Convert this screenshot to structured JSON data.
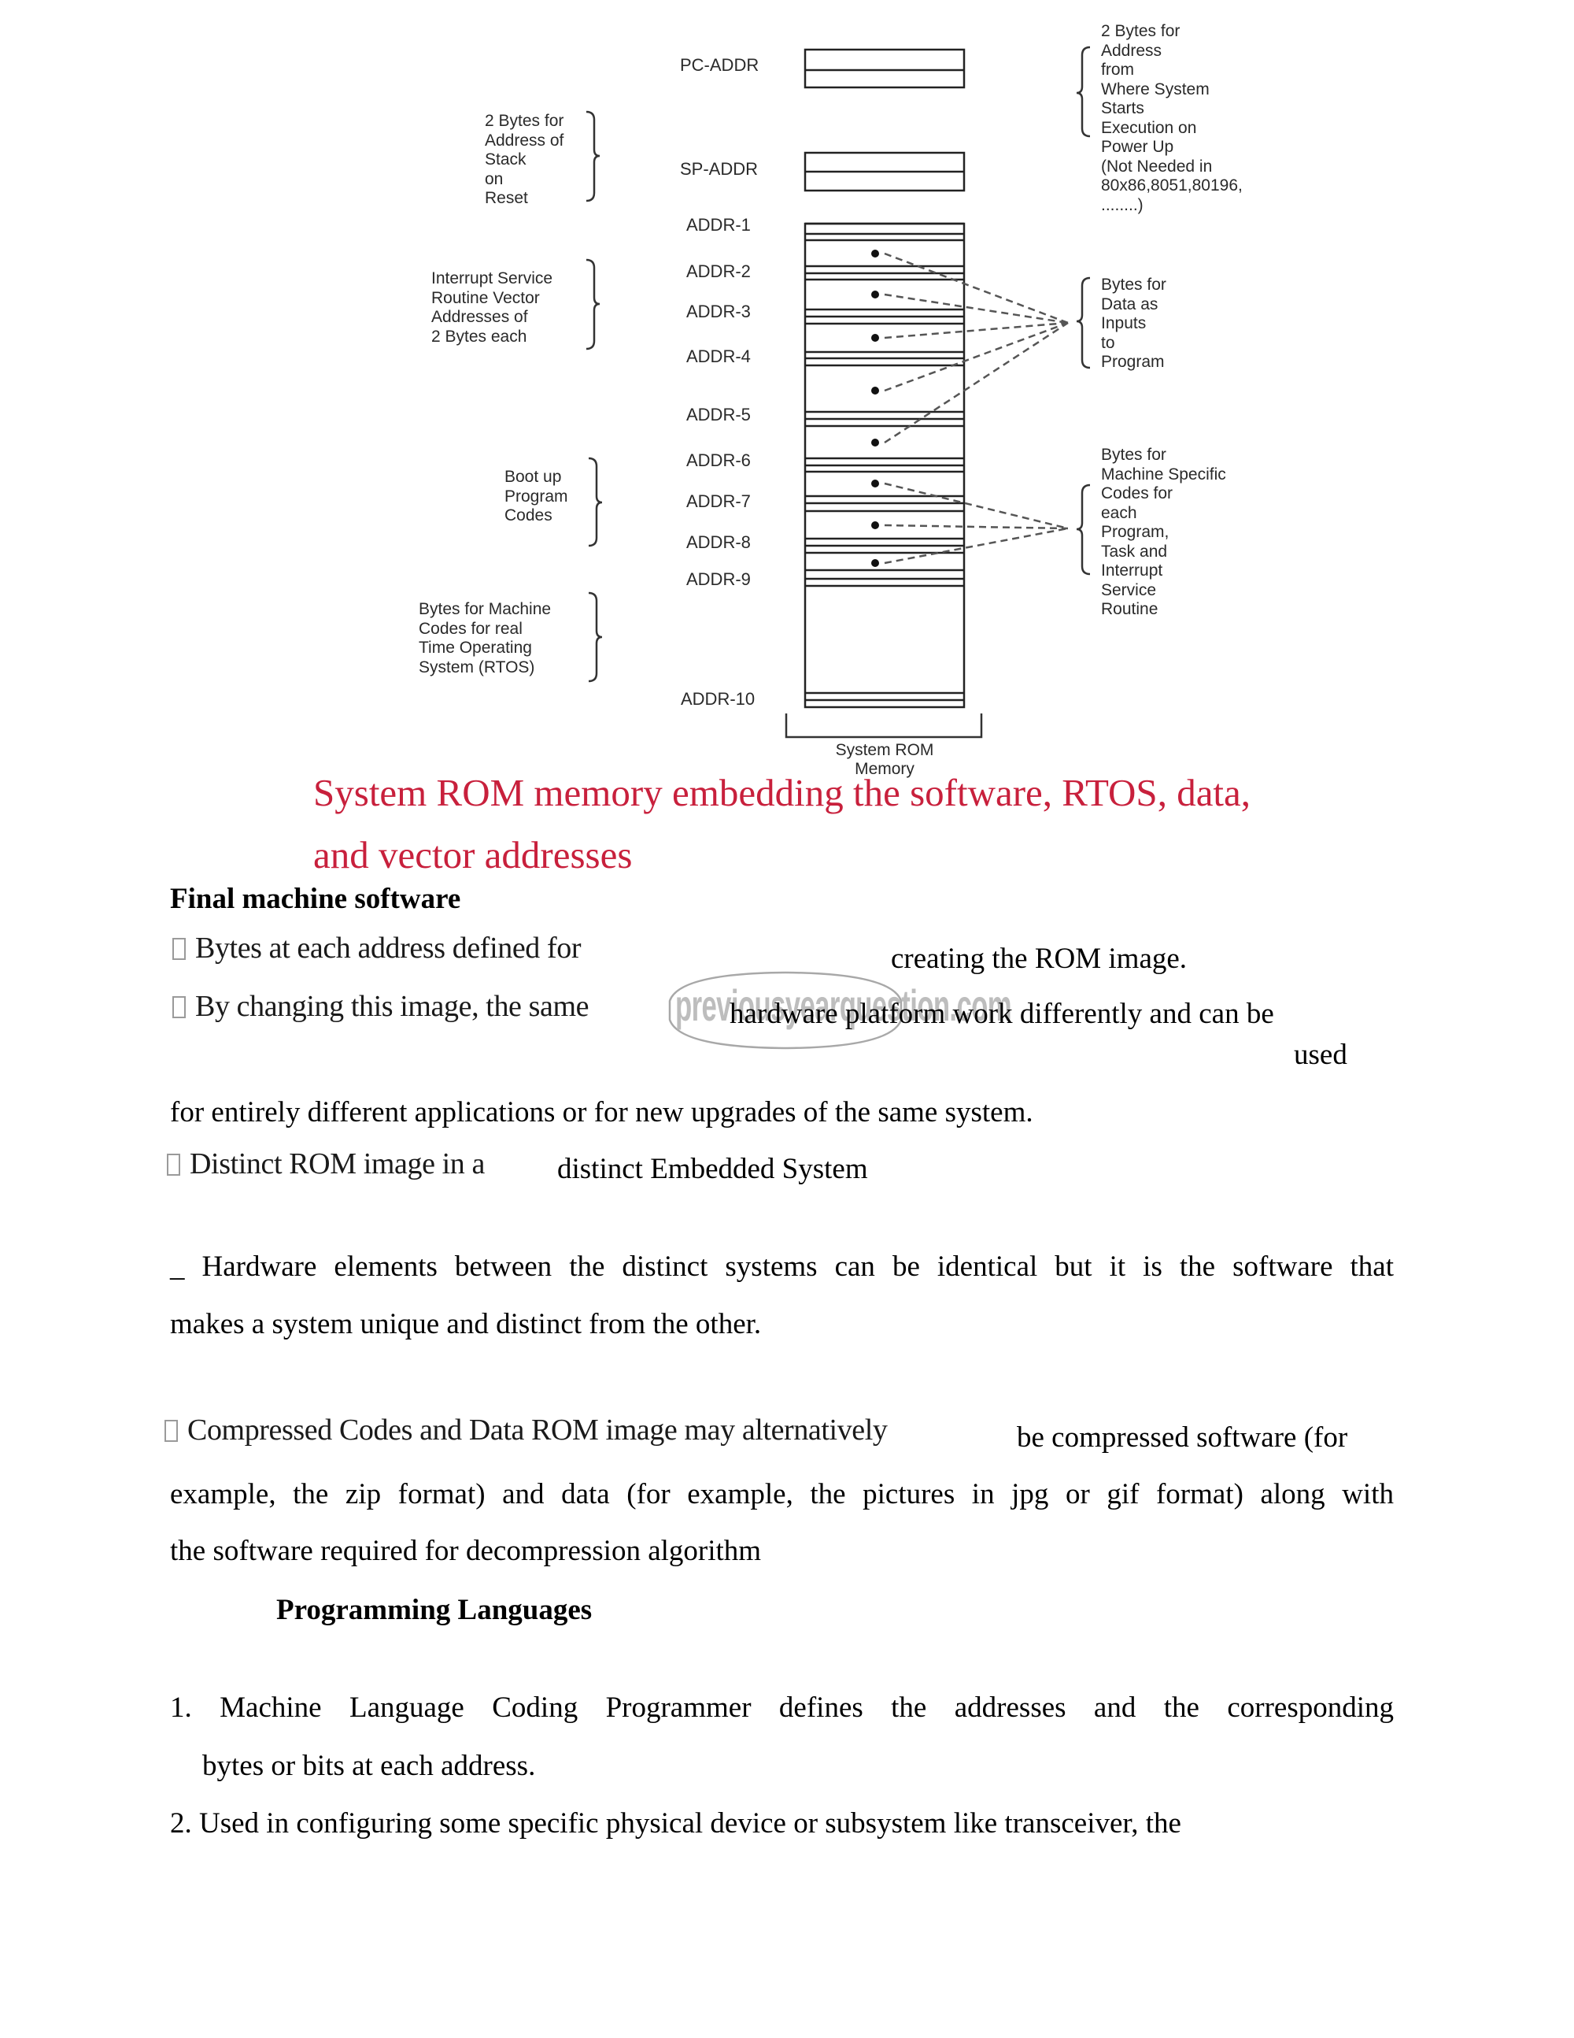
{
  "diagram": {
    "register_labels": [
      "PC-ADDR",
      "SP-ADDR"
    ],
    "addr_labels": [
      "ADDR-1",
      "ADDR-2",
      "ADDR-3",
      "ADDR-4",
      "ADDR-5",
      "ADDR-6",
      "ADDR-7",
      "ADDR-8",
      "ADDR-9",
      "ADDR-10"
    ],
    "memory_label": "System ROM\nMemory",
    "left_annotations": [
      "2 Bytes for\nAddress of\nStack\non\nReset",
      "Interrupt Service\nRoutine Vector\nAddresses of\n2 Bytes each",
      "Boot up\nProgram\nCodes",
      "Bytes for Machine\nCodes for real\nTime Operating\nSystem (RTOS)"
    ],
    "right_annotations": [
      "2 Bytes for\nAddress\nfrom\nWhere System\nStarts\nExecution on\nPower Up\n(Not Needed in\n80x86,8051,80196,\n........)",
      "Bytes for\nData as\nInputs\nto\nProgram",
      "Bytes for\nMachine Specific\nCodes for\neach\nProgram,\nTask and\nInterrupt\nService\nRoutine"
    ],
    "caption_line1": "System ROM memory embedding the software, RTOS, data,",
    "caption_line2": "and vector addresses",
    "caption_color": "#c8203c"
  },
  "watermark": "previousyearquestion.com",
  "content": {
    "heading1": "Final machine software",
    "bullet1_a": "Bytes at each address defined for",
    "bullet1_b": "creating the ROM image.",
    "bullet2_a": "By changing this image, the same",
    "bullet2_b": "hardware platform work differently and can be",
    "bullet2_c": "used",
    "para1": "for entirely different applications or for new upgrades of the same system.",
    "bullet3_a": "Distinct ROM image in a",
    "bullet3_b": "distinct Embedded System",
    "para2_l1": "_ Hardware elements between the distinct systems can be identical but it is the software that",
    "para2_l2": "makes a system unique and distinct from the other.",
    "bullet4_a": "Compressed Codes and Data ROM image may alternatively",
    "bullet4_b": "be compressed software (for",
    "para3_l1": "example, the zip format) and data (for example, the pictures in jpg or gif format) along with",
    "para3_l2": "the software required for decompression algorithm",
    "heading2": "Programming Languages",
    "list1_l1": "1. Machine Language Coding Programmer defines the addresses and the corresponding",
    "list1_l2": "bytes or bits at each address.",
    "list2_l1": "2. Used in configuring some specific physical device or subsystem like transceiver, the"
  }
}
